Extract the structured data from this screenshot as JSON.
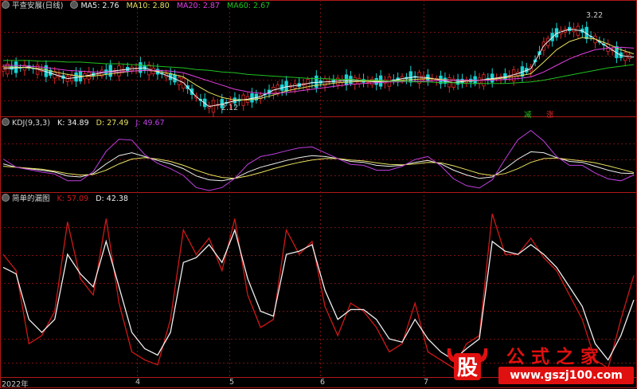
{
  "colors": {
    "up": "#e02828",
    "down": "#18d4d4",
    "grid": "#7a1010",
    "frame": "#b01818",
    "ma5": "#f0f0f0",
    "ma10": "#e8e060",
    "ma20": "#e040e0",
    "ma60": "#20c020",
    "kdj_k": "#f0f0f0",
    "kdj_d": "#e8e060",
    "kdj_j": "#c040e0",
    "lb_k": "#d01818",
    "lb_d": "#f0f0f0"
  },
  "panel1": {
    "title": "平查安展(日线)",
    "ma5": "MA5: 2.76",
    "ma10": "MA10: 2.80",
    "ma20": "MA20: 2.87",
    "ma60": "MA60: 2.67",
    "high_callout": "3.22",
    "low_callout": "2.12",
    "tag_jian": "减",
    "tag_zhang": "涨"
  },
  "panel2": {
    "title": "KDJ(9,3,3)",
    "k": "K: 34.89",
    "d": "D: 27.49",
    "j": "J: 49.67"
  },
  "panel3": {
    "title": "简单的漏图",
    "k": "K: 57.09",
    "d": "D: 42.38"
  },
  "x_axis": [
    "2022年",
    "4",
    "5",
    "6",
    "7"
  ],
  "watermark": {
    "logo_char": "股",
    "title": "公式之家",
    "url": "www.gszj100.com"
  },
  "chart_data": [
    {
      "type": "line",
      "title": "平查安展(日线)",
      "series": [
        {
          "name": "MA5",
          "values": [
            2.62,
            2.63,
            2.64,
            2.6,
            2.55,
            2.5,
            2.52,
            2.55,
            2.58,
            2.6,
            2.62,
            2.63,
            2.58,
            2.52,
            2.45,
            2.28,
            2.16,
            2.19,
            2.23,
            2.25,
            2.28,
            2.36,
            2.4,
            2.42,
            2.45,
            2.46,
            2.47,
            2.48,
            2.47,
            2.46,
            2.47,
            2.5,
            2.52,
            2.51,
            2.48,
            2.45,
            2.47,
            2.48,
            2.5,
            2.52,
            2.56,
            2.62,
            2.9,
            3.05,
            3.1,
            3.08,
            2.98,
            2.88,
            2.78,
            2.76
          ]
        },
        {
          "name": "MA10",
          "values": [
            2.64,
            2.64,
            2.63,
            2.62,
            2.58,
            2.55,
            2.53,
            2.53,
            2.55,
            2.57,
            2.59,
            2.6,
            2.59,
            2.56,
            2.52,
            2.42,
            2.33,
            2.27,
            2.24,
            2.24,
            2.26,
            2.3,
            2.35,
            2.38,
            2.41,
            2.43,
            2.45,
            2.46,
            2.47,
            2.47,
            2.47,
            2.48,
            2.49,
            2.5,
            2.49,
            2.48,
            2.47,
            2.48,
            2.49,
            2.51,
            2.53,
            2.56,
            2.7,
            2.85,
            2.95,
            3.0,
            2.98,
            2.92,
            2.85,
            2.8
          ]
        },
        {
          "name": "MA20",
          "values": [
            2.66,
            2.66,
            2.65,
            2.64,
            2.62,
            2.6,
            2.59,
            2.58,
            2.58,
            2.58,
            2.59,
            2.6,
            2.6,
            2.59,
            2.57,
            2.52,
            2.47,
            2.42,
            2.37,
            2.34,
            2.32,
            2.32,
            2.33,
            2.35,
            2.37,
            2.39,
            2.41,
            2.43,
            2.44,
            2.45,
            2.46,
            2.46,
            2.47,
            2.47,
            2.48,
            2.48,
            2.48,
            2.48,
            2.48,
            2.49,
            2.5,
            2.52,
            2.58,
            2.66,
            2.74,
            2.8,
            2.85,
            2.87,
            2.88,
            2.87
          ]
        },
        {
          "name": "MA60",
          "values": [
            2.72,
            2.72,
            2.72,
            2.71,
            2.71,
            2.7,
            2.7,
            2.69,
            2.68,
            2.68,
            2.67,
            2.66,
            2.65,
            2.64,
            2.63,
            2.61,
            2.6,
            2.58,
            2.57,
            2.55,
            2.54,
            2.53,
            2.52,
            2.51,
            2.5,
            2.5,
            2.49,
            2.49,
            2.48,
            2.48,
            2.47,
            2.47,
            2.46,
            2.46,
            2.45,
            2.45,
            2.44,
            2.44,
            2.44,
            2.44,
            2.45,
            2.46,
            2.48,
            2.51,
            2.54,
            2.57,
            2.6,
            2.63,
            2.65,
            2.67
          ]
        }
      ]
    },
    {
      "type": "line",
      "title": "KDJ(9,3,3)",
      "series": [
        {
          "name": "K",
          "values": [
            55,
            48,
            45,
            42,
            38,
            30,
            28,
            35,
            55,
            72,
            78,
            70,
            62,
            55,
            45,
            30,
            22,
            20,
            25,
            38,
            48,
            55,
            62,
            68,
            72,
            70,
            66,
            60,
            58,
            52,
            50,
            52,
            58,
            62,
            55,
            42,
            32,
            25,
            28,
            45,
            65,
            80,
            78,
            68,
            60,
            58,
            50,
            42,
            36,
            35
          ]
        },
        {
          "name": "D",
          "values": [
            50,
            48,
            46,
            44,
            40,
            35,
            32,
            33,
            42,
            55,
            65,
            68,
            65,
            60,
            52,
            42,
            33,
            27,
            25,
            30,
            37,
            45,
            52,
            58,
            63,
            66,
            66,
            63,
            61,
            57,
            54,
            53,
            55,
            58,
            57,
            51,
            43,
            35,
            31,
            35,
            45,
            58,
            66,
            67,
            64,
            61,
            57,
            51,
            44,
            37
          ]
        },
        {
          "name": "J",
          "values": [
            65,
            48,
            43,
            38,
            34,
            20,
            20,
            39,
            81,
            106,
            104,
            74,
            56,
            45,
            31,
            6,
            0,
            6,
            25,
            54,
            70,
            75,
            82,
            88,
            90,
            78,
            66,
            54,
            52,
            42,
            42,
            50,
            64,
            70,
            51,
            24,
            10,
            5,
            22,
            65,
            105,
            124,
            102,
            70,
            52,
            52,
            36,
            24,
            20,
            32
          ]
        }
      ]
    },
    {
      "type": "line",
      "title": "简单的漏图",
      "series": [
        {
          "name": "K",
          "values": [
            70,
            60,
            15,
            20,
            35,
            90,
            55,
            45,
            92,
            40,
            10,
            5,
            2,
            30,
            85,
            70,
            80,
            60,
            92,
            45,
            25,
            30,
            85,
            70,
            78,
            38,
            20,
            40,
            35,
            25,
            10,
            15,
            40,
            10,
            5,
            0,
            15,
            20,
            95,
            70,
            70,
            80,
            68,
            60,
            45,
            30,
            5,
            0,
            30,
            57
          ]
        },
        {
          "name": "D",
          "values": [
            62,
            58,
            30,
            22,
            30,
            70,
            58,
            50,
            78,
            50,
            22,
            12,
            8,
            22,
            65,
            68,
            76,
            65,
            85,
            55,
            35,
            32,
            70,
            72,
            76,
            48,
            30,
            36,
            36,
            30,
            18,
            16,
            30,
            18,
            10,
            5,
            12,
            18,
            78,
            72,
            70,
            76,
            70,
            62,
            50,
            38,
            15,
            5,
            20,
            42
          ]
        }
      ]
    }
  ]
}
